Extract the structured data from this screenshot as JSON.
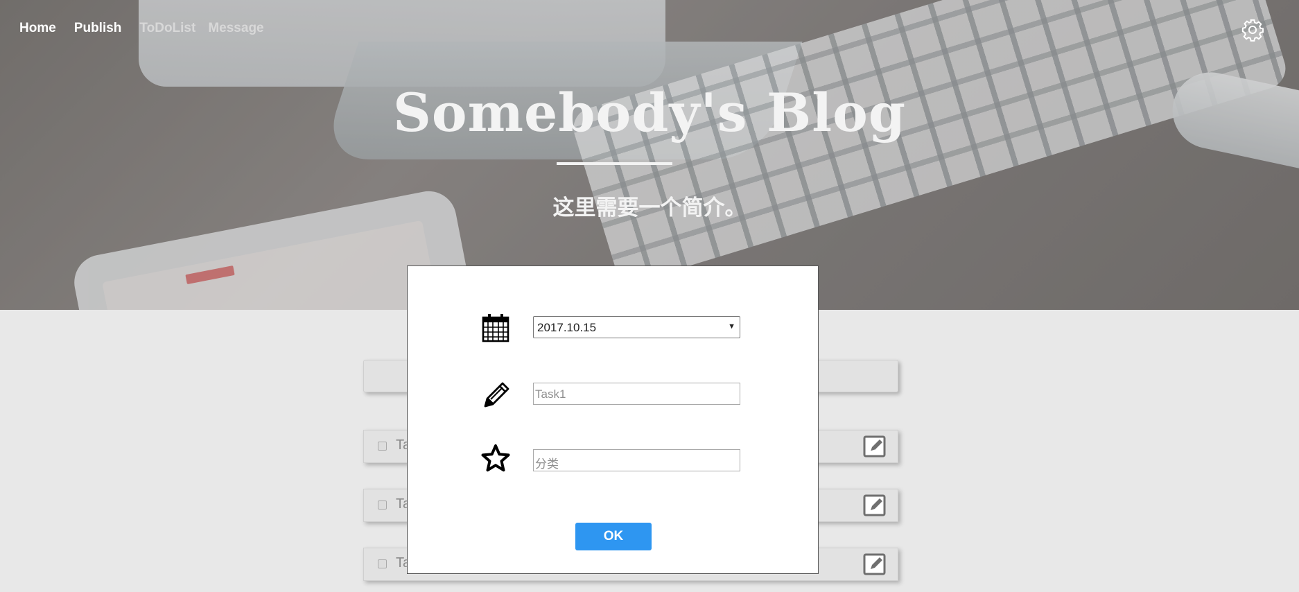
{
  "nav": {
    "items": [
      {
        "label": "Home"
      },
      {
        "label": "Publish"
      },
      {
        "label": "ToDoList"
      },
      {
        "label": "Message"
      }
    ]
  },
  "hero": {
    "title": "Somebody's Blog",
    "subtitle": "这里需要一个简介。"
  },
  "tasks": [
    {
      "label": "Ta"
    },
    {
      "label": "Ta"
    },
    {
      "label": "Ta"
    }
  ],
  "modal": {
    "date_value": "2017.10.15",
    "task_placeholder": "Task1",
    "category_placeholder": "分类",
    "ok_label": "OK"
  },
  "colors": {
    "accent": "#2e96f1",
    "page_bg": "#e8e8e8"
  },
  "icons": [
    "gear-icon",
    "calendar-icon",
    "pencil-icon",
    "star-icon",
    "edit-icon"
  ]
}
